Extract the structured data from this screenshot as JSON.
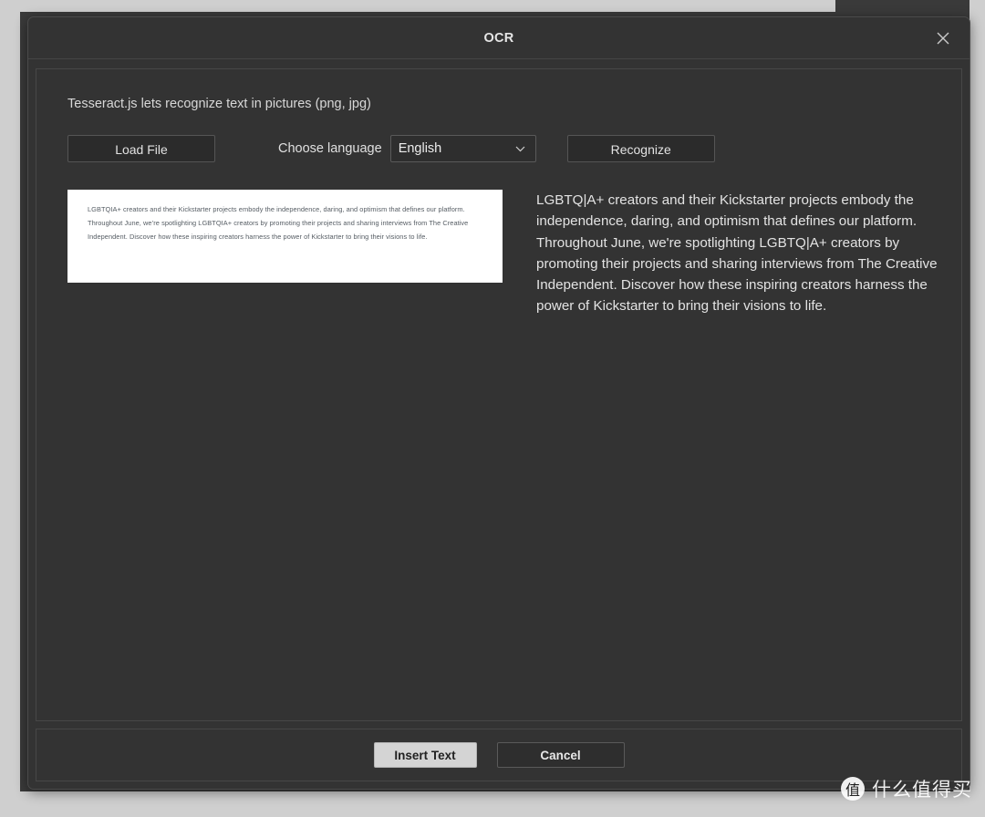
{
  "window": {
    "title": "OCR",
    "close_icon": "close-icon"
  },
  "body": {
    "description": "Tesseract.js lets recognize text in pictures (png, jpg)"
  },
  "controls": {
    "load_file_label": "Load File",
    "language_label": "Choose language",
    "language_selected": "English",
    "language_options": [
      "English"
    ],
    "chevron_icon": "chevron-down-icon",
    "recognize_label": "Recognize"
  },
  "results": {
    "image_preview_text": "LGBTQIA+ creators and their Kickstarter projects embody the independence, daring, and optimism that defines our platform. Throughout June, we’re spotlighting LGBTQIA+ creators by promoting their projects and sharing interviews from The Creative Independent. Discover how these inspiring creators harness the power of Kickstarter to bring their visions to life.",
    "ocr_output_text": "LGBTQ|A+ creators and their Kickstarter projects embody the independence, daring, and optimism that defines our platform. Throughout June, we're spotlighting LGBTQ|A+ creators by promoting their projects and sharing interviews from The Creative Independent. Discover how these inspiring creators harness the power of Kickstarter to bring their visions to life."
  },
  "footer": {
    "insert_text_label": "Insert Text",
    "cancel_label": "Cancel"
  },
  "watermark": {
    "logo_glyph": "值",
    "text": "什么值得买"
  },
  "colors": {
    "modal_bg": "#333333",
    "page_bg": "#3a3a3a",
    "light_bg": "#cfcfcf",
    "primary_button_bg": "#d4d4d4",
    "text": "#e3e3e3"
  }
}
